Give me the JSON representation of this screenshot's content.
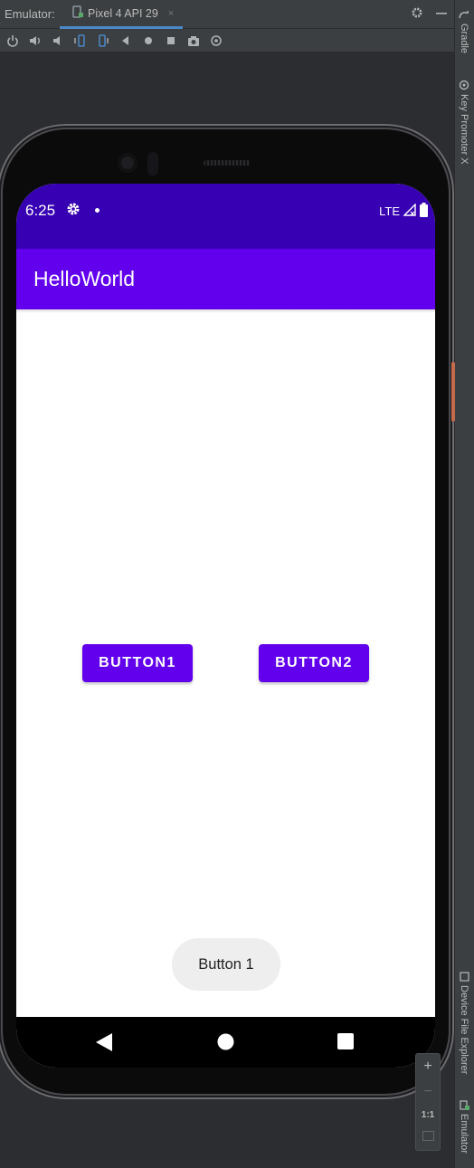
{
  "ide": {
    "panel_title": "Emulator:",
    "tab_label": "Pixel 4 API 29",
    "tab_close": "×",
    "side_tabs": {
      "gradle": "Gradle",
      "key_promoter": "Key Promoter X",
      "device_file_explorer": "Device File Explorer",
      "emulator": "Emulator"
    },
    "toolbar_icons": [
      "power-icon",
      "volume-up-icon",
      "volume-down-icon",
      "rotate-left-icon",
      "rotate-right-icon",
      "back-icon",
      "home-icon",
      "overview-icon",
      "screenshot-icon",
      "snapshot-icon"
    ],
    "zoom": {
      "plus": "+",
      "minus": "−",
      "one_to_one": "1:1"
    }
  },
  "device": {
    "status_bar": {
      "time": "6:25",
      "network": "LTE"
    },
    "app_bar": {
      "title": "HelloWorld"
    },
    "buttons": {
      "button1": "BUTTON1",
      "button2": "BUTTON2"
    },
    "toast": "Button 1",
    "colors": {
      "primary": "#6200ee",
      "primary_dark": "#3700b3",
      "accent_ide": "#4a88c7"
    }
  }
}
